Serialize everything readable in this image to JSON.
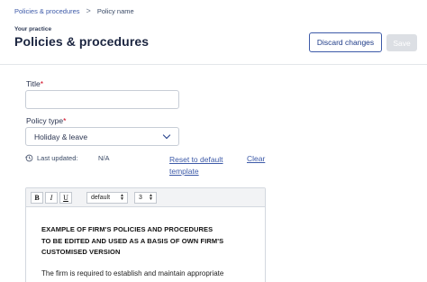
{
  "breadcrumb": {
    "parent": "Policies & procedures",
    "separator": ">",
    "current": "Policy name"
  },
  "header": {
    "eyebrow": "Your practice",
    "title": "Policies & procedures",
    "discard_label": "Discard changes",
    "save_label": "Save"
  },
  "form": {
    "title_label": "Title",
    "title_value": "",
    "required_mark": "*",
    "policy_type_label": "Policy type",
    "policy_type_value": "Holiday & leave",
    "last_updated_label": "Last updated:",
    "last_updated_value": "N/A",
    "reset_link": "Reset to default template",
    "clear_link": "Clear"
  },
  "editor": {
    "toolbar": {
      "bold": "B",
      "italic": "I",
      "underline": "U",
      "font": "default",
      "size": "3"
    },
    "heading_lines": [
      "EXAMPLE OF FIRM'S POLICIES AND PROCEDURES",
      "TO BE EDITED AND USED AS A BASIS OF OWN FIRM'S",
      "CUSTOMISED VERSION"
    ],
    "body": "The firm is required to establish and maintain appropriate"
  },
  "colors": {
    "accent": "#3d5aa8",
    "required": "#d0021b",
    "disabled": "#dcdfe4"
  }
}
